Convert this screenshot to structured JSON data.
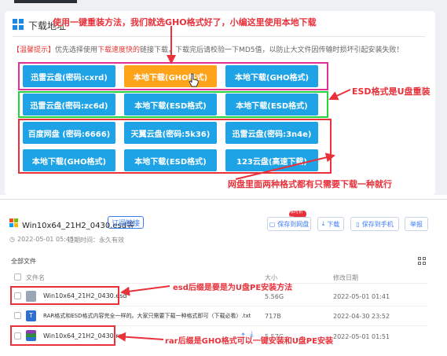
{
  "download_section": {
    "title": "下载地址",
    "tip_label": "【温馨提示】",
    "tip_text_before": "优先选择使用",
    "tip_bold": "下载速度快的",
    "tip_text_after": "链接下载，下载完后请校验一下MD5值，以防止大文件因传输时损坏引起安装失败！",
    "buttons_row1": [
      "迅雷云盘(密码:cxrd)",
      "本地下载(GHO格式)",
      "本地下载(GHO格式)"
    ],
    "buttons_row2": [
      "迅雷云盘(密码:zc6d)",
      "本地下载(ESD格式)",
      "本地下载(ESD格式)"
    ],
    "buttons_row3": [
      "百度网盘 (密码:6666)",
      "天翼云盘(密码:5k36)",
      "迅雷云盘(密码:3n4e)"
    ],
    "buttons_row4": [
      "本地下载(GHO格式)",
      "本地下载(ESD格式)",
      "123云盘(高速下载)"
    ],
    "selected_button": "本地下载(GHO格式)"
  },
  "annotations": {
    "top": "使用一键重装方法，我们就选GHO格式好了，小编这里使用本地下载",
    "esd_usb": "ESD格式是U盘重装",
    "netdisk": "网盘里面两种格式都有只需要下载一种就行",
    "esd_suffix": "esd后缀是要是为U盘PE安装方法",
    "rar_suffix": "rar后缀是GHO格式可以一键安装和U盘PE安装"
  },
  "file_share": {
    "title": "Win10x64_21H2_0430.esd等",
    "subscribe_label": "订阅链接",
    "date": "2022-05-01 05:45",
    "expiry": "过期时间：永久有效",
    "badge": "限时折扣",
    "save_to_disk": "保存到网盘",
    "download": "下载",
    "save_to_phone": "保存到手机",
    "report": "举报",
    "all_files": "全部文件",
    "columns": {
      "name": "文件名",
      "size": "大小",
      "modified": "修改日期"
    },
    "rows": [
      {
        "name": "Win10x64_21H2_0430.esd",
        "size": "5.56G",
        "modified": "2022-05-01 01:41"
      },
      {
        "name": "RAR格式和ESD格式内容完全一样的。大家只需要下载一种格式即可（下载必看）.txt",
        "size": "717B",
        "modified": "2022-04-30 23:52"
      },
      {
        "name": "Win10x64_21H2_0430.rar",
        "size": "5.57G",
        "modified": "2022-05-01 01:51"
      }
    ]
  },
  "colors": {
    "button_blue": "#1da3e6",
    "button_selected": "#ffa31a",
    "annotation_red": "#e8313a",
    "highlight_green": "#25d33c",
    "highlight_pink": "#e03296",
    "link_blue": "#3b7cf4"
  }
}
